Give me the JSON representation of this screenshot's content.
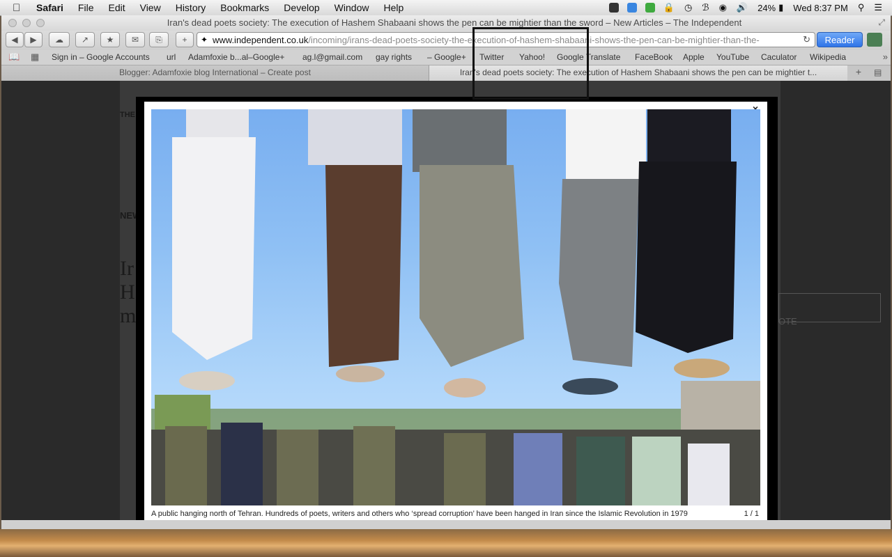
{
  "menubar": {
    "items": [
      "Safari",
      "File",
      "Edit",
      "View",
      "History",
      "Bookmarks",
      "Develop",
      "Window",
      "Help"
    ],
    "battery": "24%",
    "clock": "Wed 8:37 PM"
  },
  "window": {
    "title": "Iran's dead poets society: The execution of Hashem Shabaani shows the pen can be mightier than the sword – New Articles – The Independent"
  },
  "toolbar": {
    "url_host": "www.independent.co.uk",
    "url_path": "/incoming/irans-dead-poets-society-the-execution-of-hashem-shabaani-shows-the-pen-can-be-mightier-than-the-",
    "reader_label": "Reader"
  },
  "bookmarks": [
    "Sign in – Google Accounts",
    "url",
    "Adamfoxie b...al–Google+",
    "ag.l@gmail.com",
    "gay rights",
    "– Google+",
    "Twitter",
    "Yahoo!",
    "Google Translate",
    "FaceBook",
    "Apple",
    "YouTube",
    "Caculator",
    "Wikipedia"
  ],
  "tabs": [
    {
      "label": "Blogger: Adamfoxie blog International – Create post"
    },
    {
      "label": "Iran's dead poets society: The execution of Hashem Shabaani shows the pen can be mightier t..."
    }
  ],
  "page": {
    "frag_the": "THE",
    "frag_new": "NEW",
    "headline_letters": [
      "Ir",
      "H",
      "m"
    ],
    "note": "OTE"
  },
  "lightbox": {
    "close_label": "×",
    "caption": "A public hanging north of Tehran. Hundreds of poets, writers and others who ‘spread corruption’ have been hanged in Iran since the Islamic Revolution in 1979",
    "counter": "1 / 1"
  }
}
